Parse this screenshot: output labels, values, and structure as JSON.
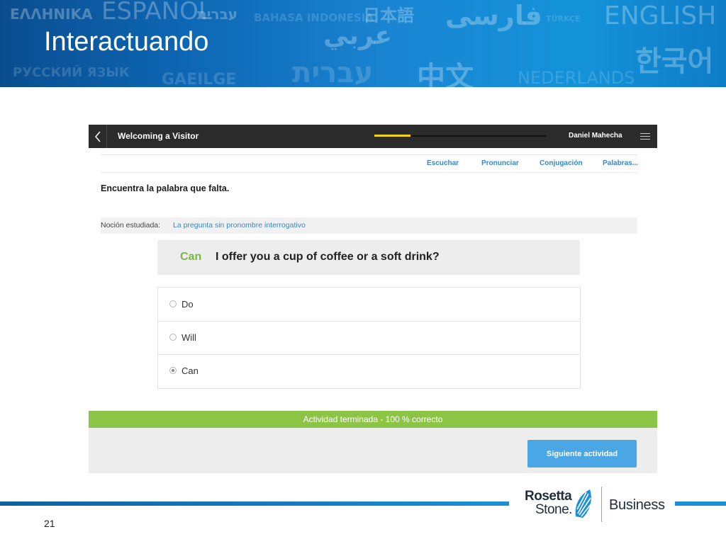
{
  "slide": {
    "title": "Interactuando",
    "page_number": "21",
    "background_words": [
      "ΕΛΛΗΝΙΚΑ",
      "ESPAÑOL",
      "עברית",
      "BAHASA INDONESIA",
      "日本語",
      "فارسی",
      "TÜRKÇE",
      "ENGLISH",
      "РУССКИЙ ЯЗЫК",
      "GAEILGE",
      "עברית",
      "中文",
      "NEDERLANDS",
      "한국어",
      "عربي"
    ],
    "colors": {
      "banner": "#1386d3",
      "accent_blue": "#3a86c8",
      "success_green": "#8cc546",
      "button_blue": "#4aa6e4",
      "header_dark": "#2b2b2b"
    }
  },
  "app": {
    "header": {
      "back_icon": "chevron-left-icon",
      "lesson_title": "Welcoming a Visitor",
      "progress": 0.21,
      "user_name": "Daniel Mahecha",
      "menu_icon": "hamburger-menu-icon"
    },
    "tabs": [
      {
        "label": "Escuchar"
      },
      {
        "label": "Pronunciar"
      },
      {
        "label": "Conjugación"
      },
      {
        "label": "Palabras..."
      }
    ],
    "instruction": "Encuentra la palabra que falta.",
    "notion": {
      "label": "Noción estudiada:",
      "link": "La pregunta sin pronombre interrogativo"
    },
    "question": {
      "answer": "Can",
      "text": "I offer you a cup of coffee or a soft drink?"
    },
    "options": [
      {
        "label": "Do",
        "selected": false
      },
      {
        "label": "Will",
        "selected": false
      },
      {
        "label": "Can",
        "selected": true
      }
    ],
    "result": "Actividad terminada - 100 % correcto",
    "next_button": "Siguiente actividad"
  },
  "logo": {
    "line1": "Rosetta",
    "line2": "Stone.",
    "product": "Business"
  }
}
